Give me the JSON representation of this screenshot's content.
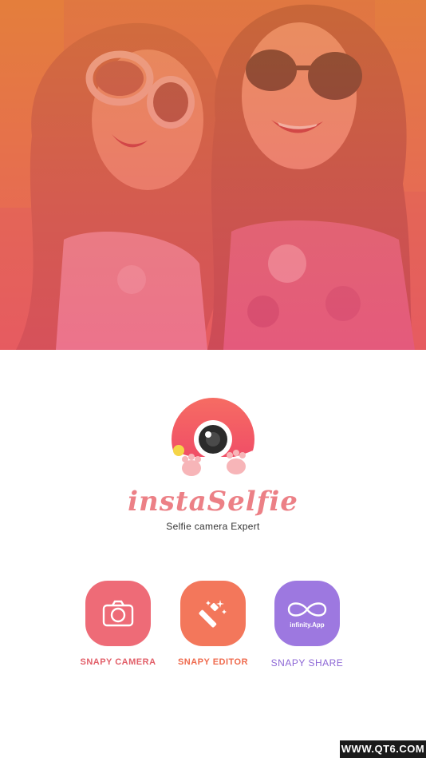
{
  "app": {
    "name": "instaSelfie",
    "tagline": "Selfie camera Expert"
  },
  "actions": [
    {
      "label": "SNAPY CAMERA",
      "icon": "camera-icon",
      "color": "#ee6b77",
      "label_color": "#e25f69"
    },
    {
      "label": "SNAPY EDITOR",
      "icon": "magic-wand-icon",
      "color": "#f3775b",
      "label_color": "#ef6a4d"
    },
    {
      "label": "SNAPY SHARE",
      "icon": "infinity-icon",
      "sub_label": "infinity.App",
      "color": "#9d78e0",
      "label_color": "#8d67d6"
    }
  ],
  "watermark": "WWW.QT6.COM",
  "colors": {
    "brand_pink": "#ec8086",
    "hero_overlay_top": "#d8733e",
    "hero_overlay_bottom": "#e5556b"
  }
}
